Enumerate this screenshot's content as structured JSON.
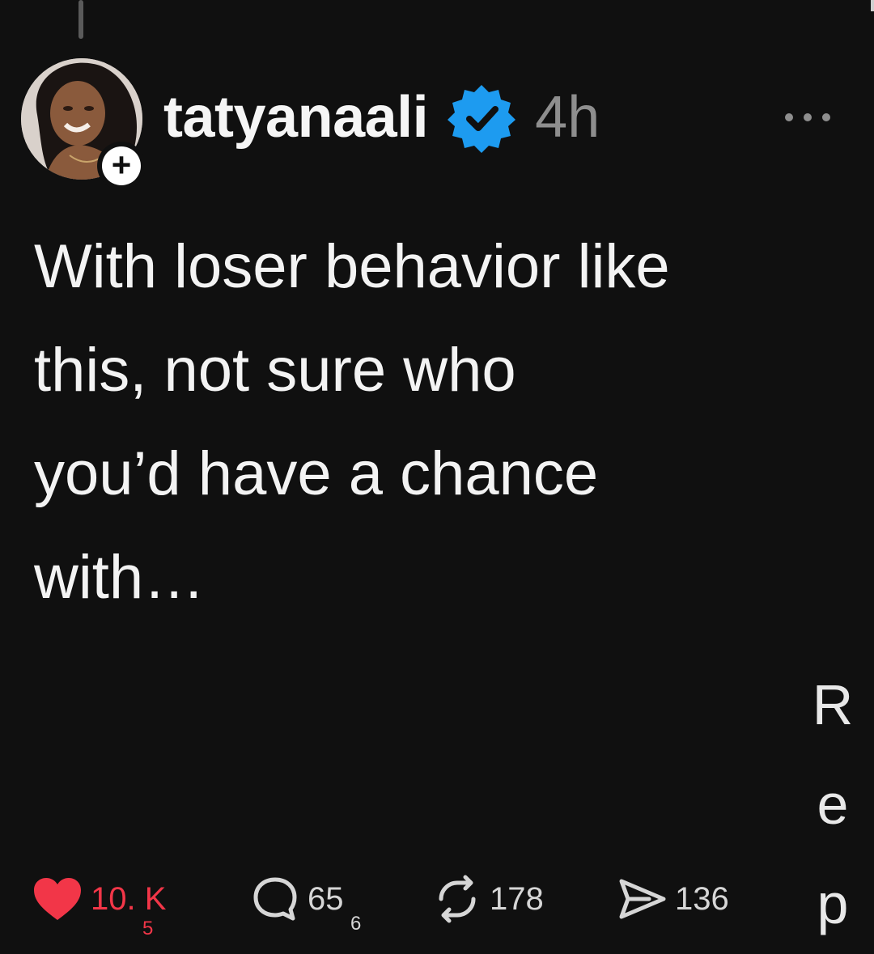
{
  "post": {
    "username": "tatyanaali",
    "timestamp": "4h",
    "text": "With loser behavior like\nthis, not sure who\nyou’d have a chance\nwith…"
  },
  "side_text": [
    "R",
    "e",
    "p"
  ],
  "actions": {
    "like": {
      "count": "10. K",
      "sub": "5",
      "icon": "heart-icon"
    },
    "reply": {
      "count": "65",
      "sub": "6",
      "icon": "comment-icon"
    },
    "repost": {
      "count": "178",
      "icon": "repost-icon"
    },
    "share": {
      "count": "136",
      "icon": "send-icon"
    }
  },
  "colors": {
    "background": "#101010",
    "verified": "#1d9bf0",
    "like": "#f23648",
    "muted": "#8e8e8e"
  }
}
